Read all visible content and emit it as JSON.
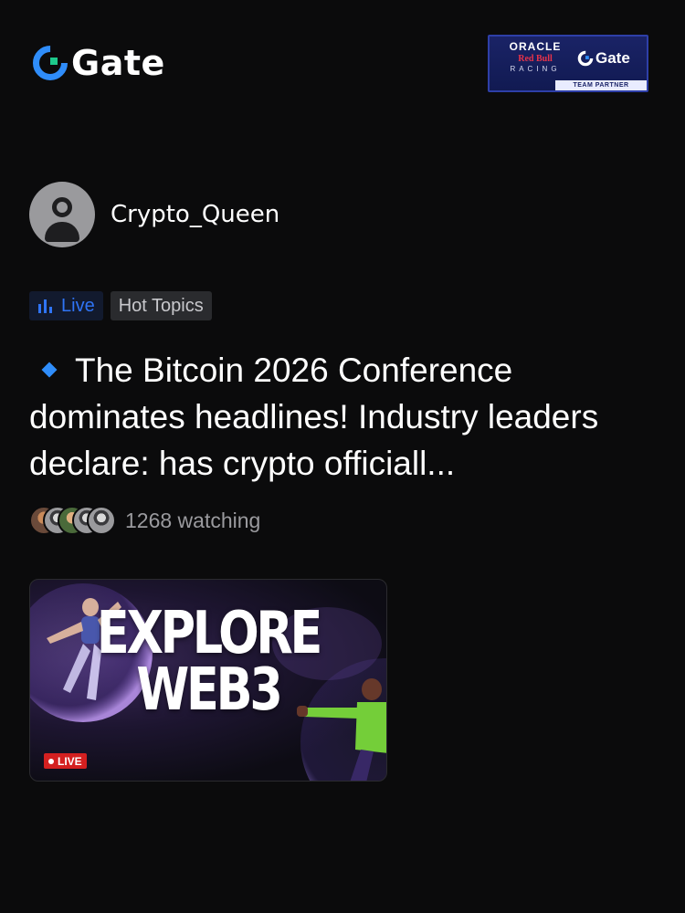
{
  "brand": {
    "name": "Gate",
    "accent": "#2f8dfa"
  },
  "partner_badge": {
    "line1": "ORACLE",
    "line2": "Red Bull",
    "line3": "RACING",
    "brand": "Gate",
    "caption": "TEAM PARTNER"
  },
  "author": {
    "name": "Crypto_Queen",
    "avatar_icon": "user-placeholder-icon"
  },
  "tags": {
    "live": "Live",
    "hot": "Hot Topics",
    "live_color": "#2f74f5"
  },
  "post": {
    "headline": "The Bitcoin 2026 Conference dominates headlines! Industry leaders declare: has crypto officiall...",
    "bullet_icon": "blue-diamond-icon"
  },
  "watching": {
    "count_text": "1268 watching"
  },
  "video": {
    "title_line1": "EXPLORE",
    "title_line2": "WEB3",
    "badge": "LIVE",
    "badge_color": "#d42020"
  }
}
